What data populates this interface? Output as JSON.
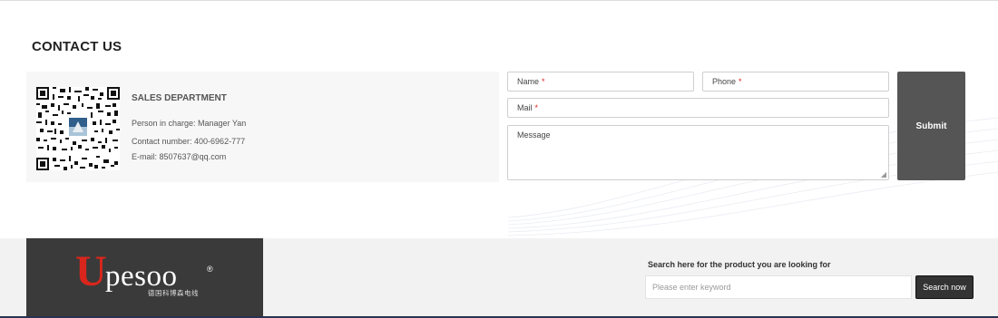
{
  "contact": {
    "title": "CONTACT US",
    "department": "SALES DEPARTMENT",
    "person": "Person in charge: Manager Yan",
    "phone": "Contact number: 400-6962-777",
    "email": "E-mail: 8507637@qq.com"
  },
  "form": {
    "name_label": "Name",
    "phone_label": "Phone",
    "mail_label": "Mail",
    "message_label": "Message",
    "required_mark": "*",
    "submit_label": "Submit"
  },
  "footer": {
    "logo_initial": "U",
    "logo_rest": "pesoo",
    "logo_registered": "®",
    "logo_subtitle": "德国科博森电线",
    "search_label": "Search here for the product you are looking for",
    "search_placeholder": "Please enter keyword",
    "search_button": "Search now"
  },
  "colors": {
    "accent_red": "#d9261c",
    "submit_bg": "#555555",
    "logo_bg": "#3a3a3a",
    "footer_bg": "#f2f2f2"
  }
}
